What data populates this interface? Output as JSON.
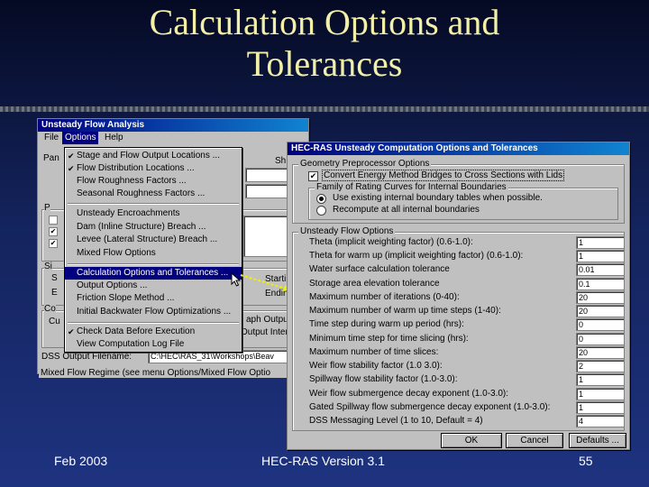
{
  "slide": {
    "title_line1": "Calculation Options and",
    "title_line2": "Tolerances",
    "footer_date": "Feb 2003",
    "footer_center": "HEC-RAS Version 3.1",
    "footer_page": "55"
  },
  "back_window": {
    "title": "Unsteady Flow Analysis",
    "menu": {
      "file": "File",
      "options": "Options",
      "help": "Help"
    },
    "fragments": {
      "pan": "Pan",
      "sh": "Sh",
      "p": "P",
      "si": "Si",
      "s": "S",
      "e": "E",
      "co": "Co",
      "cu": "Cu",
      "starting": "Starti",
      "ending": "Endin",
      "graph_output": "aph Output",
      "output_interval": "Output Interv",
      "dss_label": "DSS Output Filename:",
      "dss_value": "C:\\HEC\\RAS_31\\Workshops\\Beav",
      "mixed_flow": "Mixed Flow Regime (see menu Options/Mixed Flow Optio"
    }
  },
  "options_menu": {
    "items": [
      {
        "label": "Stage and Flow Output Locations ...",
        "checked": true
      },
      {
        "label": "Flow Distribution Locations ...",
        "checked": true
      },
      {
        "label": "Flow Roughness Factors ...",
        "checked": false
      },
      {
        "label": "Seasonal Roughness Factors ...",
        "checked": false
      },
      {
        "label": "Unsteady Encroachments",
        "checked": false
      },
      {
        "label": "Dam (Inline Structure) Breach ...",
        "checked": false
      },
      {
        "label": "Levee (Lateral Structure) Breach ...",
        "checked": false
      },
      {
        "label": "Mixed Flow Options",
        "checked": false
      },
      {
        "label": "Calculation Options and Tolerances ...",
        "checked": false
      },
      {
        "label": "Output Options ...",
        "checked": false
      },
      {
        "label": "Friction Slope Method ...",
        "checked": false
      },
      {
        "label": "Initial Backwater Flow Optimizations ...",
        "checked": false
      },
      {
        "label": "Check Data Before Execution",
        "checked": true
      },
      {
        "label": "View Computation Log File",
        "checked": false
      }
    ],
    "highlighted_index": 8
  },
  "dialog": {
    "title": "HEC-RAS Unsteady Computation Options and Tolerances",
    "geometry_group_label": "Geometry Preprocessor Options",
    "convert_energy_label": "Convert Energy Method Bridges to Cross Sections with Lids",
    "convert_energy_checked": true,
    "rating_family_label": "Family of Rating Curves for Internal Boundaries",
    "radio_existing": "Use existing internal boundary tables when possible.",
    "radio_recompute": "Recompute at all internal boundaries",
    "radio_selected": "existing",
    "unsteady_group_label": "Unsteady Flow Options",
    "options": [
      {
        "label": "Theta (implicit weighting factor) (0.6-1.0):",
        "value": "1"
      },
      {
        "label": "Theta for warm up (implicit weighting factor) (0.6-1.0):",
        "value": "1"
      },
      {
        "label": "Water surface calculation tolerance",
        "value": "0.01"
      },
      {
        "label": "Storage area elevation tolerance",
        "value": "0.1"
      },
      {
        "label": "Maximum number of iterations (0-40):",
        "value": "20"
      },
      {
        "label": "Maximum number of warm up time steps (1-40):",
        "value": "20"
      },
      {
        "label": "Time step during warm up period (hrs):",
        "value": "0"
      },
      {
        "label": "Minimum time step for time slicing (hrs):",
        "value": "0"
      },
      {
        "label": "Maximum number of time slices:",
        "value": "20"
      },
      {
        "label": "Weir flow stability factor (1.0 3.0):",
        "value": "2"
      },
      {
        "label": "Spillway flow stability factor (1.0-3.0):",
        "value": "1"
      },
      {
        "label": "Weir flow submergence decay exponent (1.0-3.0):",
        "value": "1"
      },
      {
        "label": "Gated Spillway flow submergence decay exponent (1.0-3.0):",
        "value": "1"
      },
      {
        "label": "DSS Messaging Level (1 to 10, Default = 4)",
        "value": "4"
      }
    ],
    "buttons": {
      "ok": "OK",
      "cancel": "Cancel",
      "defaults": "Defaults ..."
    }
  },
  "colors": {
    "title_text": "#f2f0a8",
    "window_face": "#c0c0c0",
    "titlebar": "#000080",
    "highlight": "#000080",
    "arrow": "#f0f000"
  }
}
